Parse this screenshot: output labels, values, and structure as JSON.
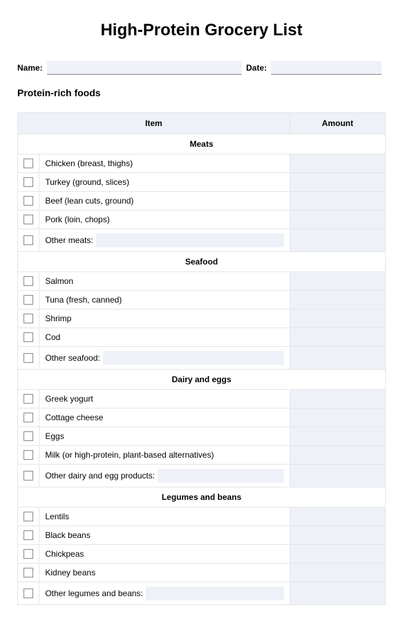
{
  "title": "High-Protein Grocery List",
  "fields": {
    "name_label": "Name:",
    "date_label": "Date:"
  },
  "subtitle": "Protein-rich foods",
  "columns": {
    "item": "Item",
    "amount": "Amount"
  },
  "sections": [
    {
      "heading": "Meats",
      "items": [
        "Chicken (breast, thighs)",
        "Turkey (ground, slices)",
        "Beef (lean cuts, ground)",
        "Pork (loin, chops)"
      ],
      "other_label": "Other meats:"
    },
    {
      "heading": "Seafood",
      "items": [
        "Salmon",
        "Tuna (fresh, canned)",
        "Shrimp",
        "Cod"
      ],
      "other_label": "Other seafood:"
    },
    {
      "heading": "Dairy and eggs",
      "items": [
        "Greek yogurt",
        "Cottage cheese",
        "Eggs",
        "Milk (or high-protein, plant-based alternatives)"
      ],
      "other_label": "Other dairy and egg products:"
    },
    {
      "heading": "Legumes and beans",
      "items": [
        "Lentils",
        "Black beans",
        "Chickpeas",
        "Kidney beans"
      ],
      "other_label": "Other legumes and beans:"
    }
  ]
}
